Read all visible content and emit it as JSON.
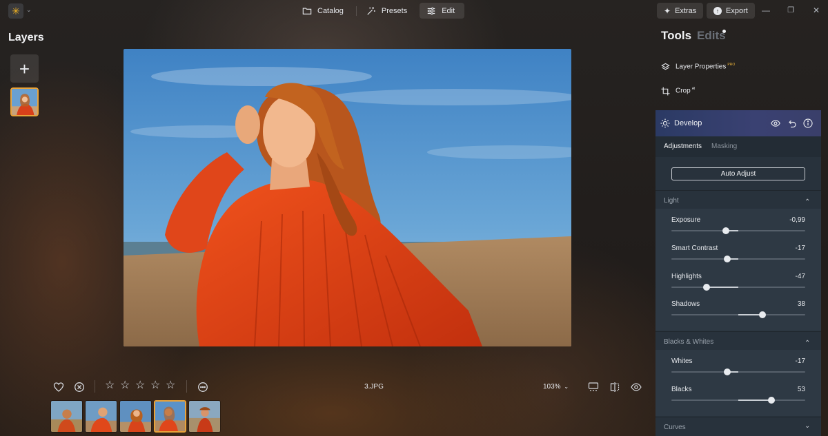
{
  "nav": {
    "catalog": "Catalog",
    "presets": "Presets",
    "edit": "Edit",
    "active": "Edit"
  },
  "window": {
    "extras": "Extras",
    "export": "Export",
    "minimize_glyph": "—",
    "restore_glyph": "❐",
    "close_glyph": "✕"
  },
  "layers": {
    "title": "Layers",
    "add_glyph": "+"
  },
  "bottom": {
    "filename": "3.JPG",
    "zoom": "103%",
    "rating_stars": 5,
    "star_glyph": "☆",
    "filmstrip_count": 5,
    "filmstrip_selected_index": 3
  },
  "tools": {
    "tab_tools": "Tools",
    "tab_edits": "Edits",
    "layer_properties": "Layer Properties",
    "layer_properties_badge": "PRO",
    "crop": "Crop",
    "crop_badge": "AI",
    "develop": "Develop",
    "subtab_adjustments": "Adjustments",
    "subtab_masking": "Masking",
    "auto_adjust": "Auto Adjust"
  },
  "sections": {
    "light": "Light",
    "blacks_whites": "Blacks & Whites",
    "curves": "Curves",
    "caret_up": "⌃",
    "caret_down": "⌄"
  },
  "sliders": {
    "exposure": {
      "label": "Exposure",
      "value": "-0,99",
      "position": 0.405,
      "center": 0.5
    },
    "smart_contrast": {
      "label": "Smart Contrast",
      "value": "-17",
      "position": 0.415,
      "center": 0.5
    },
    "highlights": {
      "label": "Highlights",
      "value": "-47",
      "position": 0.265,
      "center": 0.5
    },
    "shadows": {
      "label": "Shadows",
      "value": "38",
      "position": 0.68,
      "center": 0.5
    },
    "whites": {
      "label": "Whites",
      "value": "-17",
      "position": 0.415,
      "center": 0.5
    },
    "blacks": {
      "label": "Blacks",
      "value": "53",
      "position": 0.745,
      "center": 0.5
    }
  },
  "colors": {
    "accent": "#e9a33a",
    "panel": "#28323c",
    "develop_header": "#34406c"
  }
}
